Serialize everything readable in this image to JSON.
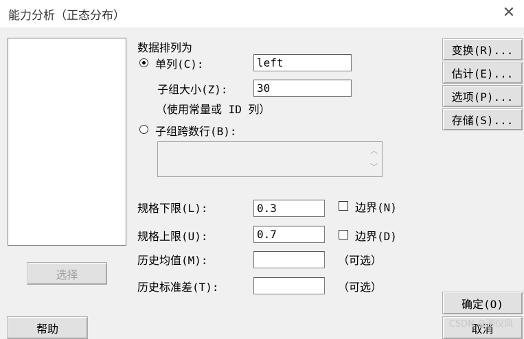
{
  "window": {
    "title": "能力分析（正态分布）",
    "close_glyph": "✕"
  },
  "data_arrangement": {
    "heading": "数据排列为",
    "single_column_label": "单列(C):",
    "single_column_value": "left",
    "subgroup_size_label": "子组大小(Z):",
    "subgroup_size_value": "30",
    "subgroup_hint": "（使用常量或 ID 列）",
    "subgroups_across_rows_label": "子组跨数行(B):",
    "scroll_up": "︿",
    "scroll_down": "﹀"
  },
  "specs": {
    "lower_label": "规格下限(L):",
    "lower_value": "0.3",
    "lower_boundary_label": "边界(N)",
    "upper_label": "规格上限(U):",
    "upper_value": "0.7",
    "upper_boundary_label": "边界(D)",
    "hist_mean_label": "历史均值(M):",
    "hist_mean_value": "",
    "hist_mean_optional": "（可选）",
    "hist_std_label": "历史标准差(T):",
    "hist_std_value": "",
    "hist_std_optional": "（可选）"
  },
  "buttons": {
    "select": "选择",
    "help": "帮助",
    "transform": "变换(R)...",
    "estimate": "估计(E)...",
    "options": "选项(P)...",
    "storage": "存储(S)...",
    "ok": "确定(O)",
    "cancel": "取消"
  },
  "watermark": "CSDN @测仪风"
}
